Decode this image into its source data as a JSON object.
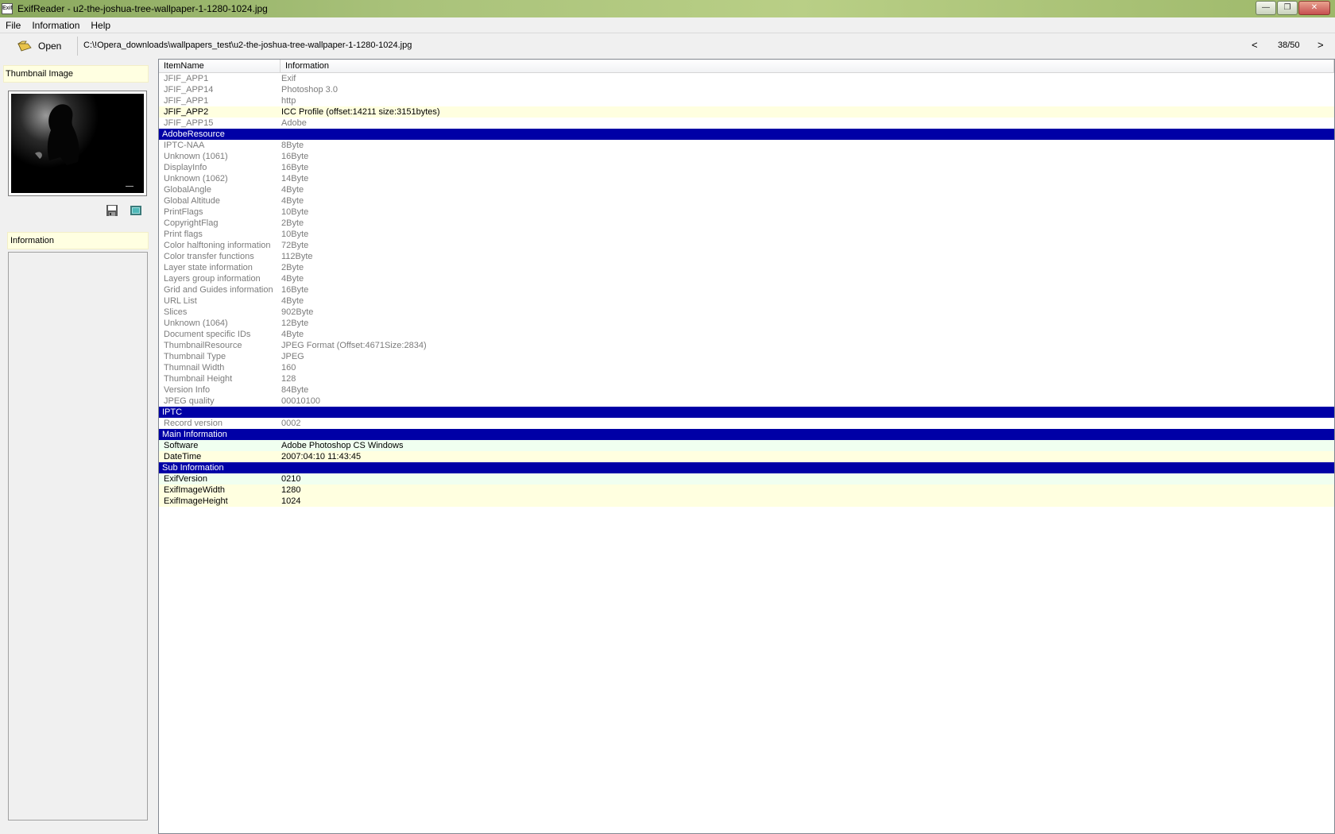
{
  "window": {
    "title": "ExifReader - u2-the-joshua-tree-wallpaper-1-1280-1024.jpg",
    "app_icon": "Exif"
  },
  "menu": [
    "File",
    "Information",
    "Help"
  ],
  "toolbar": {
    "open_label": "Open",
    "path": "C:\\!Opera_downloads\\wallpapers_test\\u2-the-joshua-tree-wallpaper-1-1280-1024.jpg",
    "prev_glyph": "<",
    "next_glyph": ">",
    "page_count": "38/50"
  },
  "left_panel": {
    "thumb_title": "Thumbnail Image",
    "info_title": "Information"
  },
  "table": {
    "headers": [
      "ItemName",
      "Information"
    ],
    "rows": [
      {
        "type": "muted",
        "name": "JFIF_APP1",
        "info": "Exif"
      },
      {
        "type": "muted",
        "name": "JFIF_APP14",
        "info": "Photoshop 3.0"
      },
      {
        "type": "muted",
        "name": "JFIF_APP1",
        "info": "http"
      },
      {
        "type": "hl",
        "name": "JFIF_APP2",
        "info": "ICC Profile (offset:14211 size:3151bytes)"
      },
      {
        "type": "muted",
        "name": "JFIF_APP15",
        "info": "Adobe"
      },
      {
        "type": "section",
        "name": "AdobeResource",
        "info": ""
      },
      {
        "type": "muted",
        "name": "IPTC-NAA",
        "info": "8Byte"
      },
      {
        "type": "muted",
        "name": "Unknown (1061)",
        "info": "16Byte"
      },
      {
        "type": "muted",
        "name": "DisplayInfo",
        "info": "16Byte"
      },
      {
        "type": "muted",
        "name": "Unknown (1062)",
        "info": "14Byte"
      },
      {
        "type": "muted",
        "name": "GlobalAngle",
        "info": "4Byte"
      },
      {
        "type": "muted",
        "name": "Global Altitude",
        "info": "4Byte"
      },
      {
        "type": "muted",
        "name": "PrintFlags",
        "info": "10Byte"
      },
      {
        "type": "muted",
        "name": "CopyrightFlag",
        "info": "2Byte"
      },
      {
        "type": "muted",
        "name": "Print flags",
        "info": "10Byte"
      },
      {
        "type": "muted",
        "name": "Color halftoning information",
        "info": "72Byte"
      },
      {
        "type": "muted",
        "name": "Color transfer functions",
        "info": "112Byte"
      },
      {
        "type": "muted",
        "name": "Layer state information",
        "info": "2Byte"
      },
      {
        "type": "muted",
        "name": "Layers group information",
        "info": "4Byte"
      },
      {
        "type": "muted",
        "name": "Grid and Guides information",
        "info": "16Byte"
      },
      {
        "type": "muted",
        "name": "URL List",
        "info": "4Byte"
      },
      {
        "type": "muted",
        "name": "Slices",
        "info": "902Byte"
      },
      {
        "type": "muted",
        "name": "Unknown (1064)",
        "info": "12Byte"
      },
      {
        "type": "muted",
        "name": "Document specific IDs",
        "info": "4Byte"
      },
      {
        "type": "muted",
        "name": "ThumbnailResource",
        "info": "JPEG Format (Offset:4671Size:2834)"
      },
      {
        "type": "muted",
        "name": "Thumbnail Type",
        "info": "JPEG"
      },
      {
        "type": "muted",
        "name": "Thumnail Width",
        "info": "160"
      },
      {
        "type": "muted",
        "name": "Thumbnail Height",
        "info": "128"
      },
      {
        "type": "muted",
        "name": "Version Info",
        "info": "84Byte"
      },
      {
        "type": "muted",
        "name": "JPEG quality",
        "info": "00010100"
      },
      {
        "type": "section",
        "name": "IPTC",
        "info": ""
      },
      {
        "type": "muted",
        "name": "Record version",
        "info": "0002"
      },
      {
        "type": "section",
        "name": "Main Information",
        "info": ""
      },
      {
        "type": "hl2",
        "name": "Software",
        "info": "Adobe Photoshop CS Windows"
      },
      {
        "type": "hl",
        "name": "DateTime",
        "info": "2007:04:10 11:43:45"
      },
      {
        "type": "section",
        "name": "Sub Information",
        "info": ""
      },
      {
        "type": "hl2",
        "name": "ExifVersion",
        "info": "0210"
      },
      {
        "type": "hl",
        "name": "ExifImageWidth",
        "info": "1280"
      },
      {
        "type": "hl",
        "name": "ExifImageHeight",
        "info": "1024"
      }
    ]
  }
}
